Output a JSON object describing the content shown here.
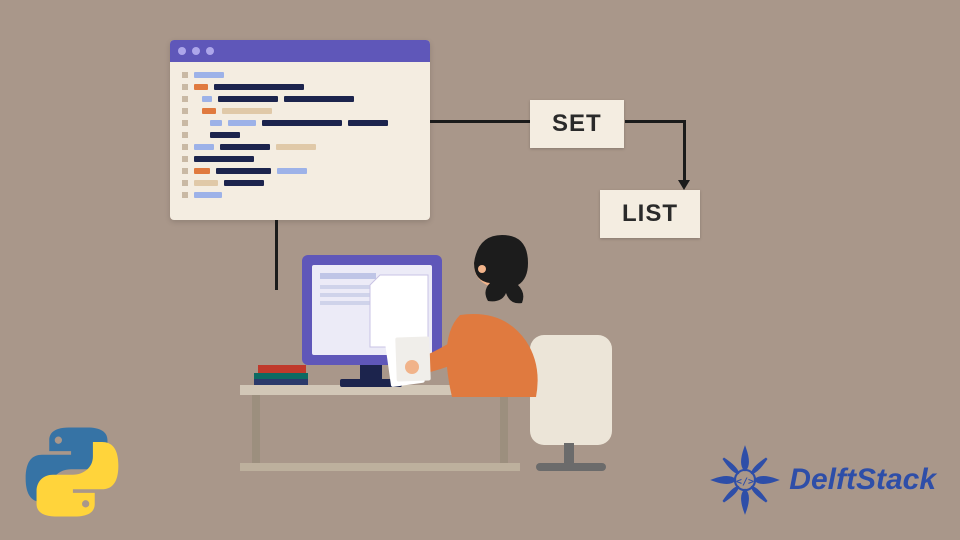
{
  "labels": {
    "set": "SET",
    "list": "LIST"
  },
  "brand": {
    "name": "DelftStack"
  },
  "icons": {
    "language": "python",
    "cornerBrand": "delftstack-mandala"
  },
  "colors": {
    "bg": "#a9978a",
    "panel": "#f4ede1",
    "purple": "#5f57b9",
    "orange": "#e07a3f",
    "navy": "#1c244d",
    "brandBlue": "#2e4ea8"
  },
  "illustration": {
    "description": "Person seated at a desk with a monitor, a floating code editor window, and arrows connecting to two labeled boxes: SET → LIST."
  }
}
